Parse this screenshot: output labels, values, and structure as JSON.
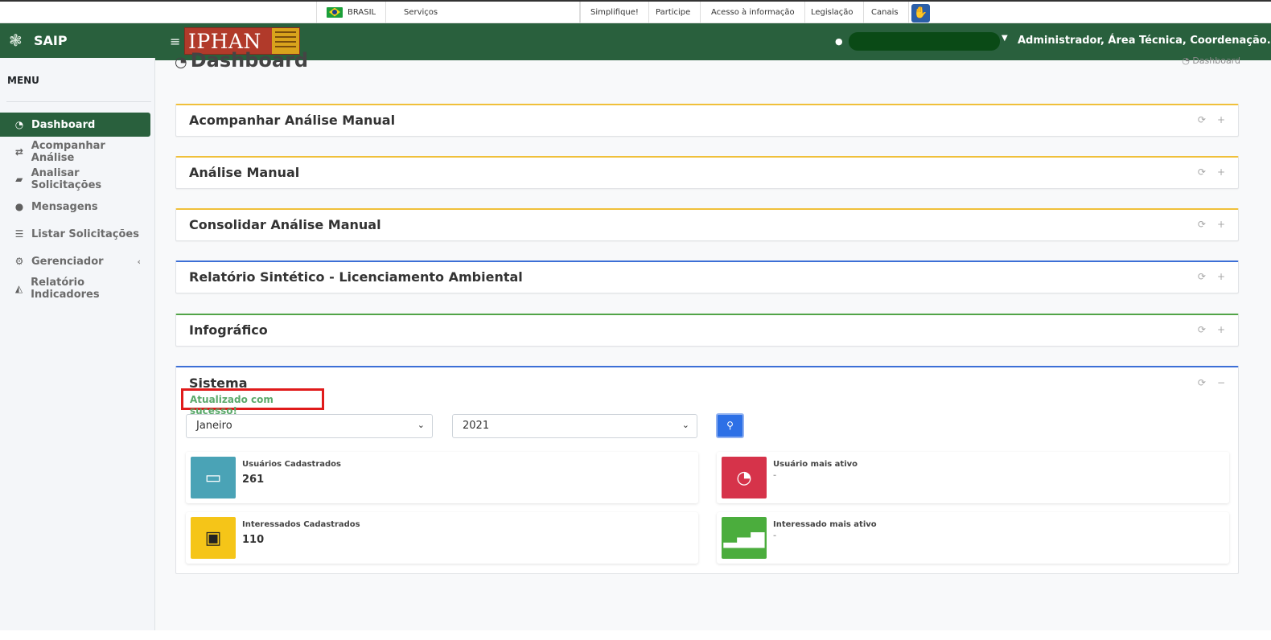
{
  "govbar": {
    "brasil": "BRASIL",
    "servicos": "Serviços",
    "simplifique": "Simplifique!",
    "participe": "Participe",
    "acesso": "Acesso à informação",
    "legislacao": "Legislação",
    "canais": "Canais",
    "accessibility_icon": "accessibility-hands-icon"
  },
  "header": {
    "app_name": "SAIP",
    "logo_text": "IPHAN",
    "user_label": "Administrador, Área Técnica, Coordenação..."
  },
  "sidebar": {
    "menu_title": "MENU",
    "items": [
      {
        "label": "Dashboard",
        "icon": "tachometer-icon"
      },
      {
        "label": "Acompanhar Análise",
        "icon": "exchange-icon"
      },
      {
        "label": "Analisar Solicitações",
        "icon": "book-icon"
      },
      {
        "label": "Mensagens",
        "icon": "comments-icon"
      },
      {
        "label": "Listar Solicitações",
        "icon": "list-icon"
      },
      {
        "label": "Gerenciador",
        "icon": "cogs-icon"
      },
      {
        "label": "Relatório Indicadores",
        "icon": "area-chart-icon"
      }
    ]
  },
  "page": {
    "title": "Dashboard",
    "breadcrumb": "Dashboard"
  },
  "cards": [
    {
      "title": "Acompanhar Análise Manual",
      "accent": "#f0c03a"
    },
    {
      "title": "Análise Manual",
      "accent": "#f0c03a"
    },
    {
      "title": "Consolidar Análise Manual",
      "accent": "#f0c03a"
    },
    {
      "title": "Relatório Sintético - Licenciamento Ambiental",
      "accent": "#3c6fd6"
    },
    {
      "title": "Infográfico",
      "accent": "#52a447"
    }
  ],
  "sistema": {
    "title": "Sistema",
    "success_message": "Atualizado com sucesso!",
    "month_value": "Janeiro",
    "year_value": "2021",
    "stats": [
      {
        "label": "Usuários Cadastrados",
        "value": "261",
        "color": "#4aa3b6",
        "icon": "id-card-icon"
      },
      {
        "label": "Usuário mais ativo",
        "value": "-",
        "color": "#d6334a",
        "icon": "dashboard-gauge-icon"
      },
      {
        "label": "Interessados Cadastrados",
        "value": "110",
        "color": "#f5c518",
        "icon": "briefcase-icon"
      },
      {
        "label": "Interessado mais ativo",
        "value": "-",
        "color": "#4bad3d",
        "icon": "signal-bars-icon"
      }
    ]
  },
  "colors": {
    "primary_green": "#29603d",
    "search_blue": "#2d70e6",
    "success_text": "#5aa96a",
    "highlight_red": "#e01b1b"
  }
}
